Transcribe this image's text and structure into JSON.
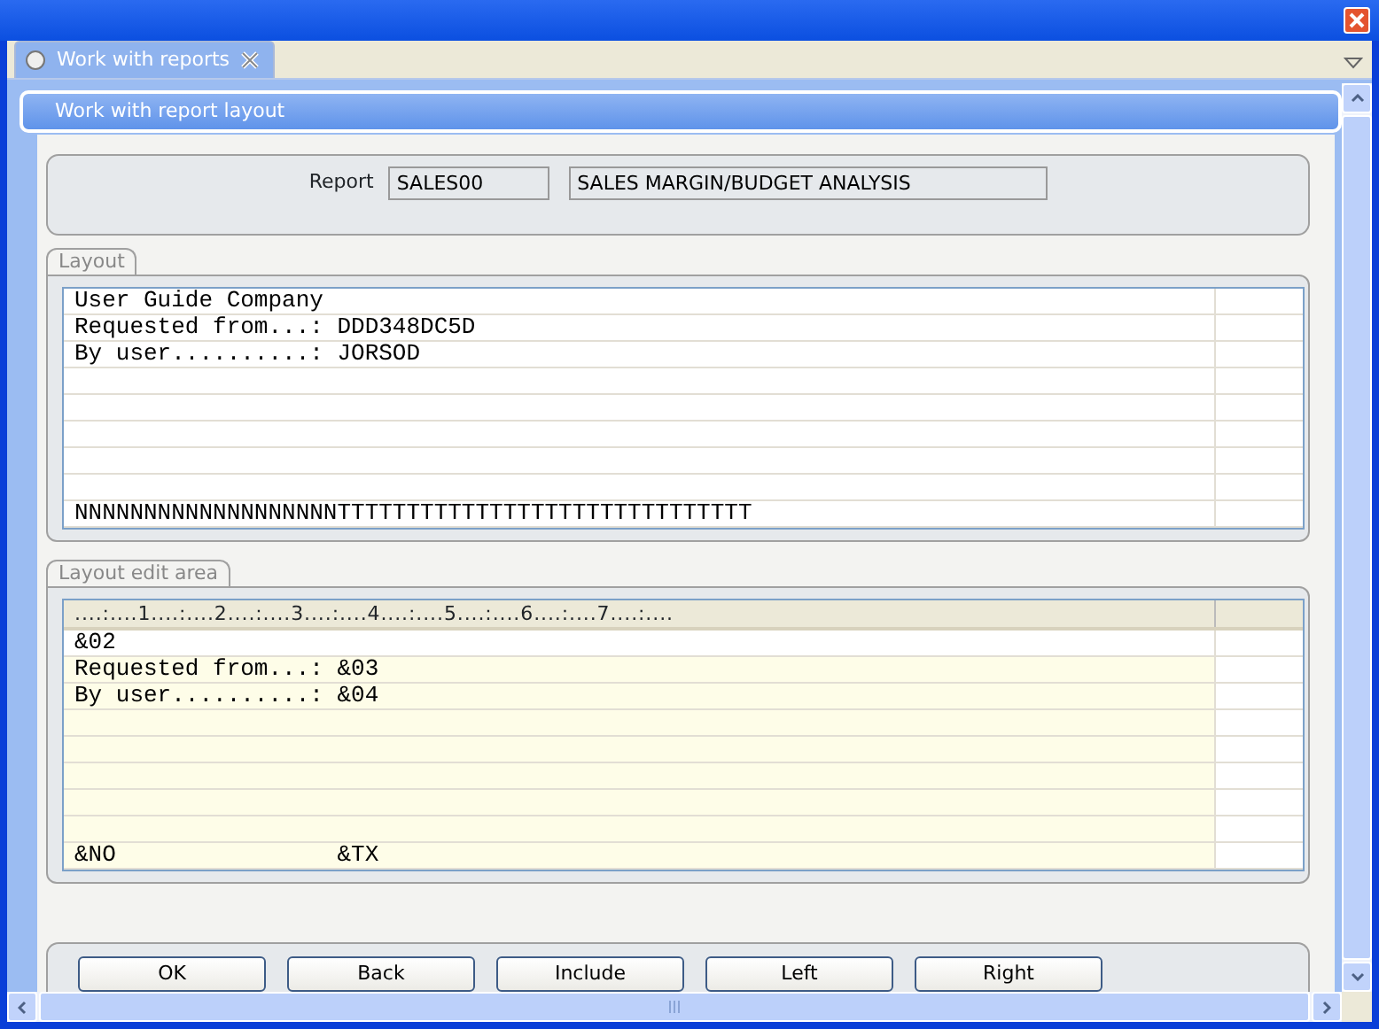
{
  "tabs": [
    {
      "label": "Work with reports",
      "selected": true
    }
  ],
  "header": {
    "title": "Work with report layout"
  },
  "report": {
    "label": "Report",
    "code": "SALES00",
    "description": "SALES MARGIN/BUDGET ANALYSIS"
  },
  "layout": {
    "title": "Layout",
    "rows": [
      {
        "text": "User Guide Company"
      },
      {
        "text": "Requested from...: DDD348DC5D"
      },
      {
        "text": "By user..........: JORSOD"
      },
      {},
      {},
      {},
      {},
      {},
      {
        "text": "NNNNNNNNNNNNNNNNNNNTTTTTTTTTTTTTTTTTTTTTTTTTTTTTT"
      }
    ]
  },
  "edit_area": {
    "title": "Layout edit area",
    "ruler": "....:....1....:....2....:....3....:....4....:....5....:....6....:....7....:....",
    "rows": [
      {
        "text": "&02",
        "highlighted": false
      },
      {
        "text": "Requested from...: &03",
        "highlighted": true
      },
      {
        "text": "By user..........: &04",
        "highlighted": true
      },
      {
        "highlighted": true
      },
      {
        "highlighted": true
      },
      {
        "highlighted": true
      },
      {
        "highlighted": true
      },
      {
        "highlighted": true
      },
      {
        "text": "&NO                &TX",
        "highlighted": true
      }
    ]
  },
  "buttons": [
    "OK",
    "Back",
    "Include",
    "Left",
    "Right"
  ]
}
